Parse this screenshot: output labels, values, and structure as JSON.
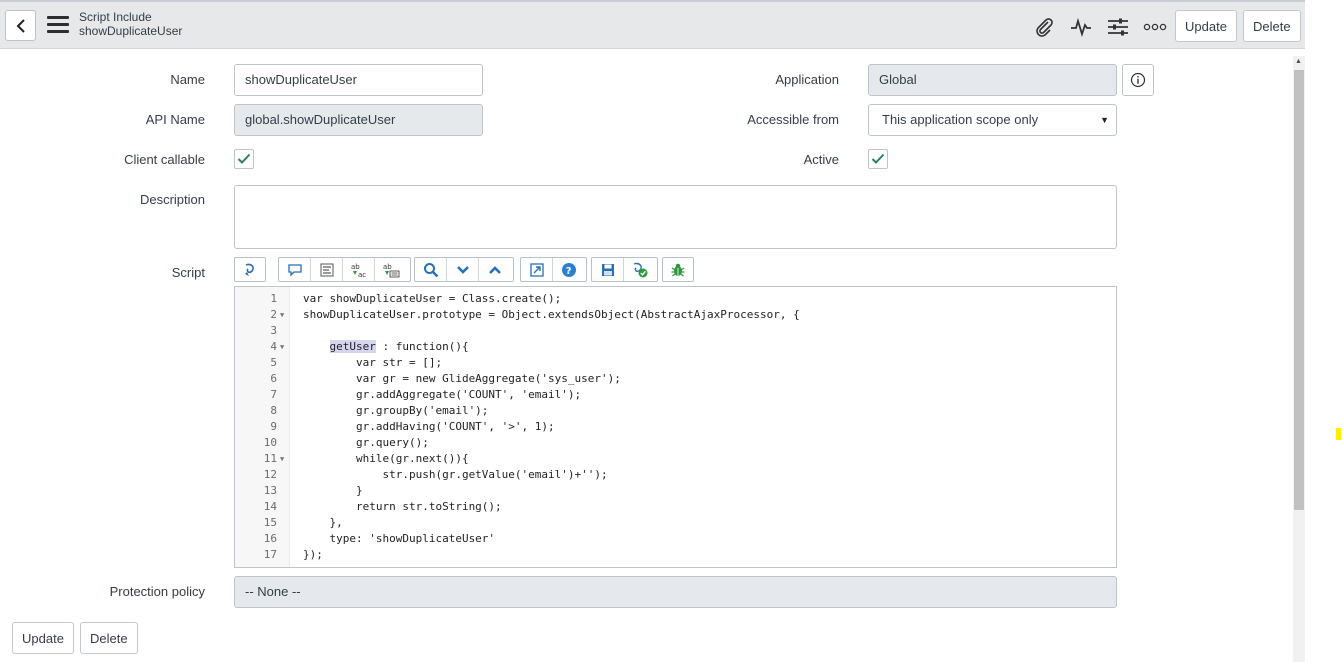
{
  "header": {
    "record_type": "Script Include",
    "record_name": "showDuplicateUser",
    "update_label": "Update",
    "delete_label": "Delete",
    "icons": [
      "back-icon",
      "menu-icon",
      "paperclip-icon",
      "activity-icon",
      "settings-sliders-icon",
      "more-options-icon"
    ]
  },
  "form": {
    "name_label": "Name",
    "name_value": "showDuplicateUser",
    "api_name_label": "API Name",
    "api_name_value": "global.showDuplicateUser",
    "client_callable_label": "Client callable",
    "client_callable_checked": true,
    "description_label": "Description",
    "description_value": "",
    "script_label": "Script",
    "application_label": "Application",
    "application_value": "Global",
    "accessible_from_label": "Accessible from",
    "accessible_from_value": "This application scope only",
    "active_label": "Active",
    "active_checked": true,
    "protection_policy_label": "Protection policy",
    "protection_policy_value": "-- None --"
  },
  "toolbar_icons": [
    "script-switch-icon",
    "comment-icon",
    "format-icon",
    "replace-icon",
    "replace-all-icon",
    "search-icon",
    "next-icon",
    "previous-icon",
    "fullscreen-icon",
    "help-icon",
    "save-icon",
    "syntax-check-icon",
    "debug-icon"
  ],
  "editor": {
    "highlight_word": "getUser",
    "lines": [
      {
        "num": "1",
        "text": "var showDuplicateUser = Class.create();",
        "fold": false
      },
      {
        "num": "2",
        "text": "showDuplicateUser.prototype = Object.extendsObject(AbstractAjaxProcessor, {",
        "fold": true
      },
      {
        "num": "3",
        "text": "",
        "fold": false
      },
      {
        "num": "4",
        "text": "    getUser : function(){",
        "fold": true
      },
      {
        "num": "5",
        "text": "        var str = [];",
        "fold": false
      },
      {
        "num": "6",
        "text": "        var gr = new GlideAggregate('sys_user');",
        "fold": false
      },
      {
        "num": "7",
        "text": "        gr.addAggregate('COUNT', 'email');",
        "fold": false
      },
      {
        "num": "8",
        "text": "        gr.groupBy('email');",
        "fold": false
      },
      {
        "num": "9",
        "text": "        gr.addHaving('COUNT', '>', 1);",
        "fold": false
      },
      {
        "num": "10",
        "text": "        gr.query();",
        "fold": false
      },
      {
        "num": "11",
        "text": "        while(gr.next()){",
        "fold": true
      },
      {
        "num": "12",
        "text": "            str.push(gr.getValue('email')+'');",
        "fold": false
      },
      {
        "num": "13",
        "text": "        }",
        "fold": false
      },
      {
        "num": "14",
        "text": "        return str.toString();",
        "fold": false
      },
      {
        "num": "15",
        "text": "    },",
        "fold": false
      },
      {
        "num": "16",
        "text": "    type: 'showDuplicateUser'",
        "fold": false
      },
      {
        "num": "17",
        "text": "});",
        "fold": false
      }
    ]
  },
  "footer": {
    "update_label": "Update",
    "delete_label": "Delete"
  }
}
